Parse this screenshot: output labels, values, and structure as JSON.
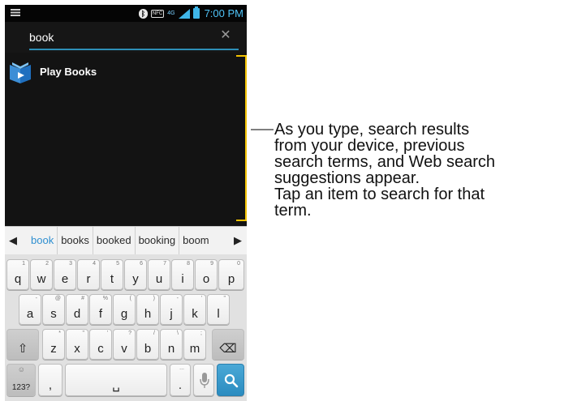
{
  "status_bar": {
    "time": "7:00 PM",
    "icons": [
      "menu-icon",
      "bluetooth-icon",
      "nfc-icon",
      "lte-4g-icon",
      "signal-icon",
      "battery-icon"
    ],
    "nfc_text": "NFC",
    "lte_text": "4G"
  },
  "search": {
    "value": "book",
    "clear_icon": "close-icon",
    "accent_color": "#2e8fb7"
  },
  "results": [
    {
      "label": "Play Books",
      "icon": "play-books-icon"
    }
  ],
  "suggestions": {
    "items": [
      "book",
      "books",
      "booked",
      "booking",
      "boom"
    ],
    "left_arrow": "◀",
    "right_arrow": "▶"
  },
  "keyboard": {
    "row1": [
      {
        "main": "q",
        "sub": "1"
      },
      {
        "main": "w",
        "sub": "2"
      },
      {
        "main": "e",
        "sub": "3"
      },
      {
        "main": "r",
        "sub": "4"
      },
      {
        "main": "t",
        "sub": "5"
      },
      {
        "main": "y",
        "sub": "6"
      },
      {
        "main": "u",
        "sub": "7"
      },
      {
        "main": "i",
        "sub": "8"
      },
      {
        "main": "o",
        "sub": "9"
      },
      {
        "main": "p",
        "sub": "0"
      }
    ],
    "row2": [
      {
        "main": "a",
        "sub": "-"
      },
      {
        "main": "s",
        "sub": "@"
      },
      {
        "main": "d",
        "sub": "#"
      },
      {
        "main": "f",
        "sub": "%"
      },
      {
        "main": "g",
        "sub": "("
      },
      {
        "main": "h",
        "sub": ")"
      },
      {
        "main": "j",
        "sub": "-"
      },
      {
        "main": "k",
        "sub": "'"
      },
      {
        "main": "l",
        "sub": "\""
      }
    ],
    "row3": [
      {
        "main": "z",
        "sub": "*"
      },
      {
        "main": "x",
        "sub": "\""
      },
      {
        "main": "c",
        "sub": "'"
      },
      {
        "main": "v",
        "sub": "?"
      },
      {
        "main": "b",
        "sub": "/"
      },
      {
        "main": "n",
        "sub": "\\"
      },
      {
        "main": "m",
        "sub": ";"
      }
    ],
    "shift_symbol": "⇧",
    "backspace_symbol": "⌫",
    "mode_label": "123?",
    "mode_sub": "☺",
    "comma_label": ",",
    "period_label": ".",
    "period_sub": "...",
    "space_symbol": "␣",
    "mic_icon": "microphone-icon",
    "search_icon": "search-icon",
    "accent_color": "#2b8cc0"
  },
  "annotation": {
    "lines": [
      "As you type, search results",
      "from your device, previous",
      "search terms, and Web search",
      "suggestions appear.",
      "Tap an item to search for that",
      "term."
    ],
    "bracket_color": "#f2c200"
  }
}
